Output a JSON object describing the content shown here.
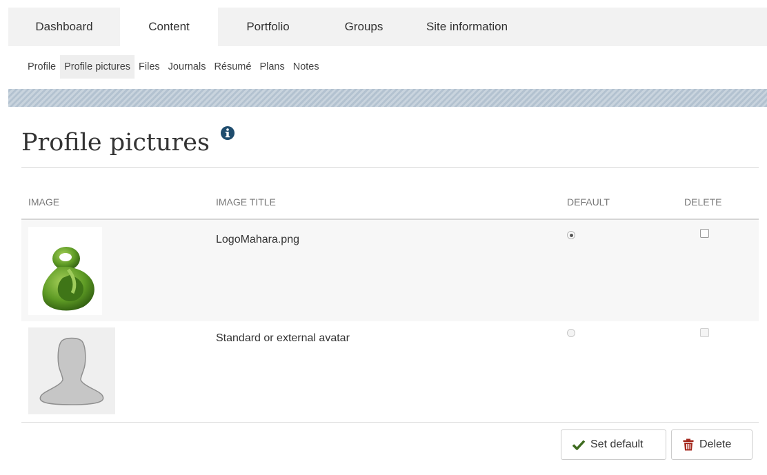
{
  "main_nav": {
    "tabs": [
      {
        "label": "Dashboard"
      },
      {
        "label": "Content"
      },
      {
        "label": "Portfolio"
      },
      {
        "label": "Groups"
      },
      {
        "label": "Site information"
      }
    ],
    "active": "Content"
  },
  "sub_nav": {
    "items": [
      {
        "label": "Profile"
      },
      {
        "label": "Profile pictures"
      },
      {
        "label": "Files"
      },
      {
        "label": "Journals"
      },
      {
        "label": "Résumé"
      },
      {
        "label": "Plans"
      },
      {
        "label": "Notes"
      }
    ],
    "active": "Profile pictures"
  },
  "page": {
    "title": "Profile pictures",
    "info_icon": "info-circle-icon"
  },
  "table": {
    "columns": {
      "image": "IMAGE",
      "image_title": "IMAGE TITLE",
      "default": "DEFAULT",
      "delete": "DELETE"
    },
    "rows": [
      {
        "title": "LogoMahara.png",
        "thumbnail": "mahara-logo",
        "is_default": true,
        "delete_checked": false,
        "delete_enabled": true
      },
      {
        "title": "Standard or external avatar",
        "thumbnail": "default-avatar-silhouette",
        "is_default": false,
        "delete_checked": false,
        "delete_enabled": false
      }
    ]
  },
  "actions": {
    "set_default_label": "Set default",
    "delete_label": "Delete"
  },
  "colors": {
    "nav_background": "#f2f2f2",
    "stripe": "#b3c2d0",
    "check_icon": "#3d6b1e",
    "trash_icon": "#a52a1f",
    "info_icon": "#1f4d6e"
  }
}
